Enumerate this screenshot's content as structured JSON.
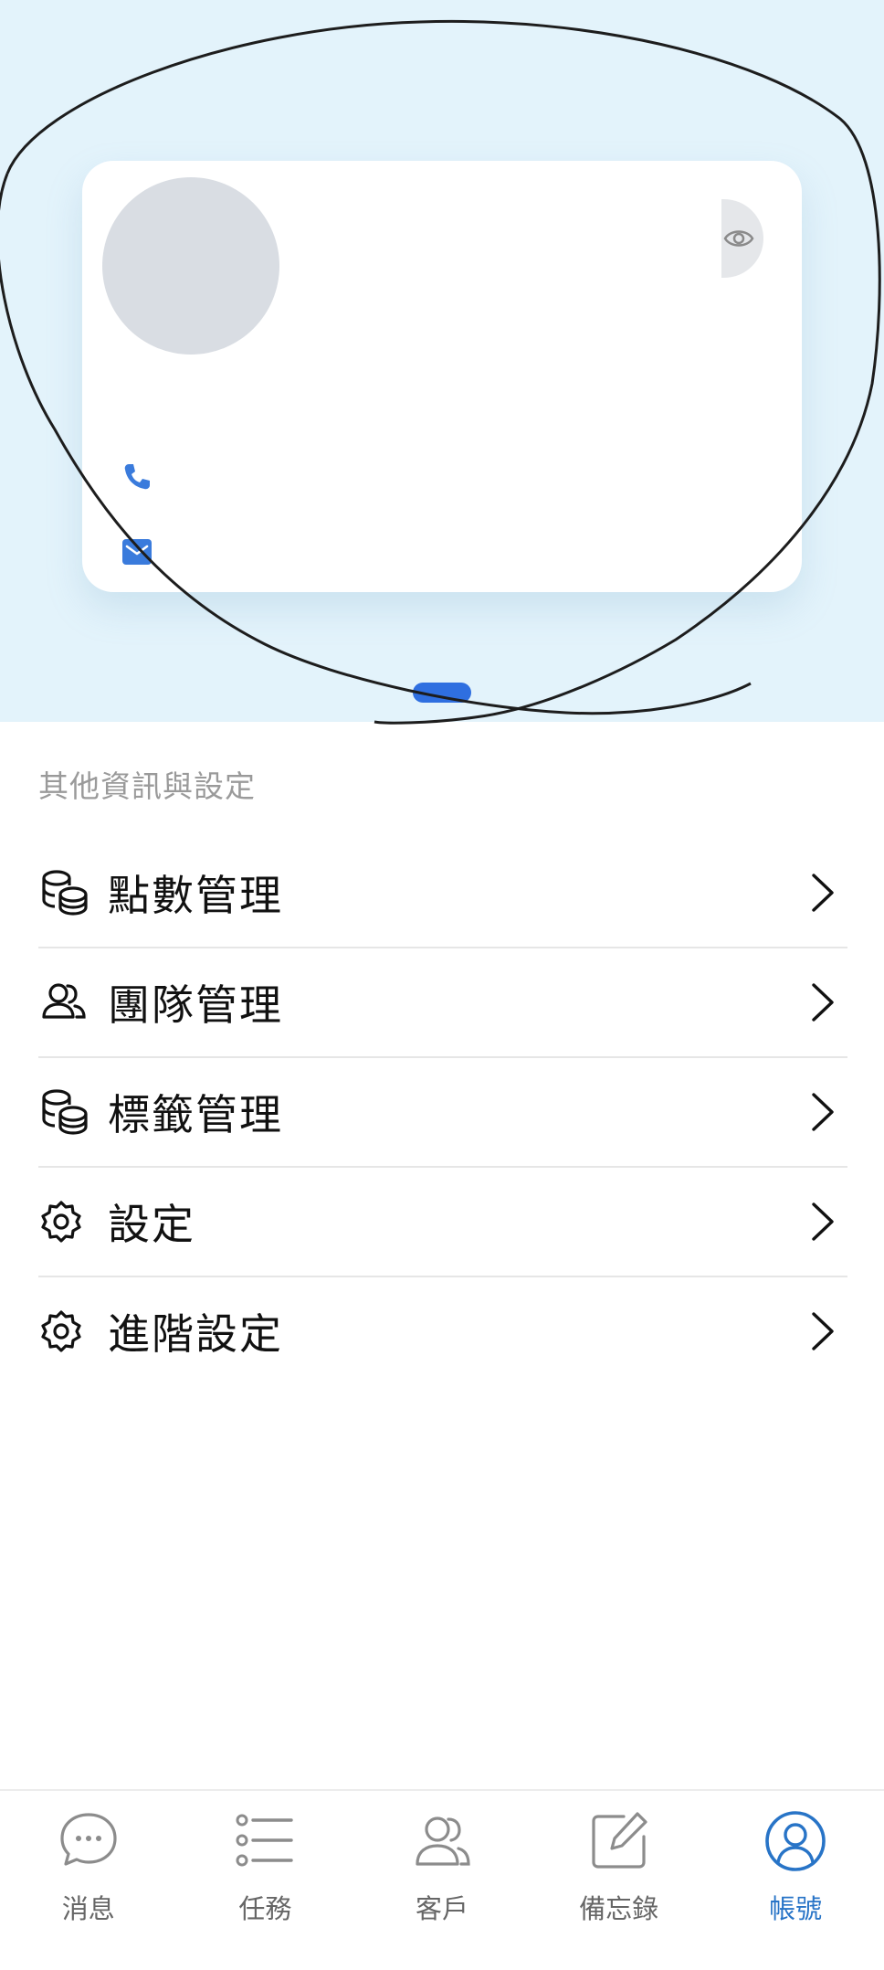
{
  "colors": {
    "hero_background": "#e3f3fb",
    "accent": "#2f6fe0",
    "active_tab": "#2874c7",
    "inactive_tab": "#666666",
    "section_title": "#9a9a9a"
  },
  "profile_card": {
    "avatar_icon": "avatar-placeholder",
    "visibility_icon": "eye-icon",
    "phone_icon": "phone-icon",
    "email_icon": "mail-icon",
    "carousel_pages": 1,
    "carousel_active": 1
  },
  "settings": {
    "section_title": "其他資訊與設定",
    "items": [
      {
        "label": "點數管理",
        "icon": "coins-icon"
      },
      {
        "label": "團隊管理",
        "icon": "team-icon"
      },
      {
        "label": "標籤管理",
        "icon": "coins-icon"
      },
      {
        "label": "設定",
        "icon": "gear-icon"
      },
      {
        "label": "進階設定",
        "icon": "gear-icon"
      }
    ]
  },
  "tabbar": {
    "items": [
      {
        "label": "消息",
        "icon": "chat-bubble-icon",
        "active": false
      },
      {
        "label": "任務",
        "icon": "list-icon",
        "active": false
      },
      {
        "label": "客戶",
        "icon": "customers-icon",
        "active": false
      },
      {
        "label": "備忘錄",
        "icon": "memo-edit-icon",
        "active": false
      },
      {
        "label": "帳號",
        "icon": "account-icon",
        "active": true
      }
    ]
  }
}
